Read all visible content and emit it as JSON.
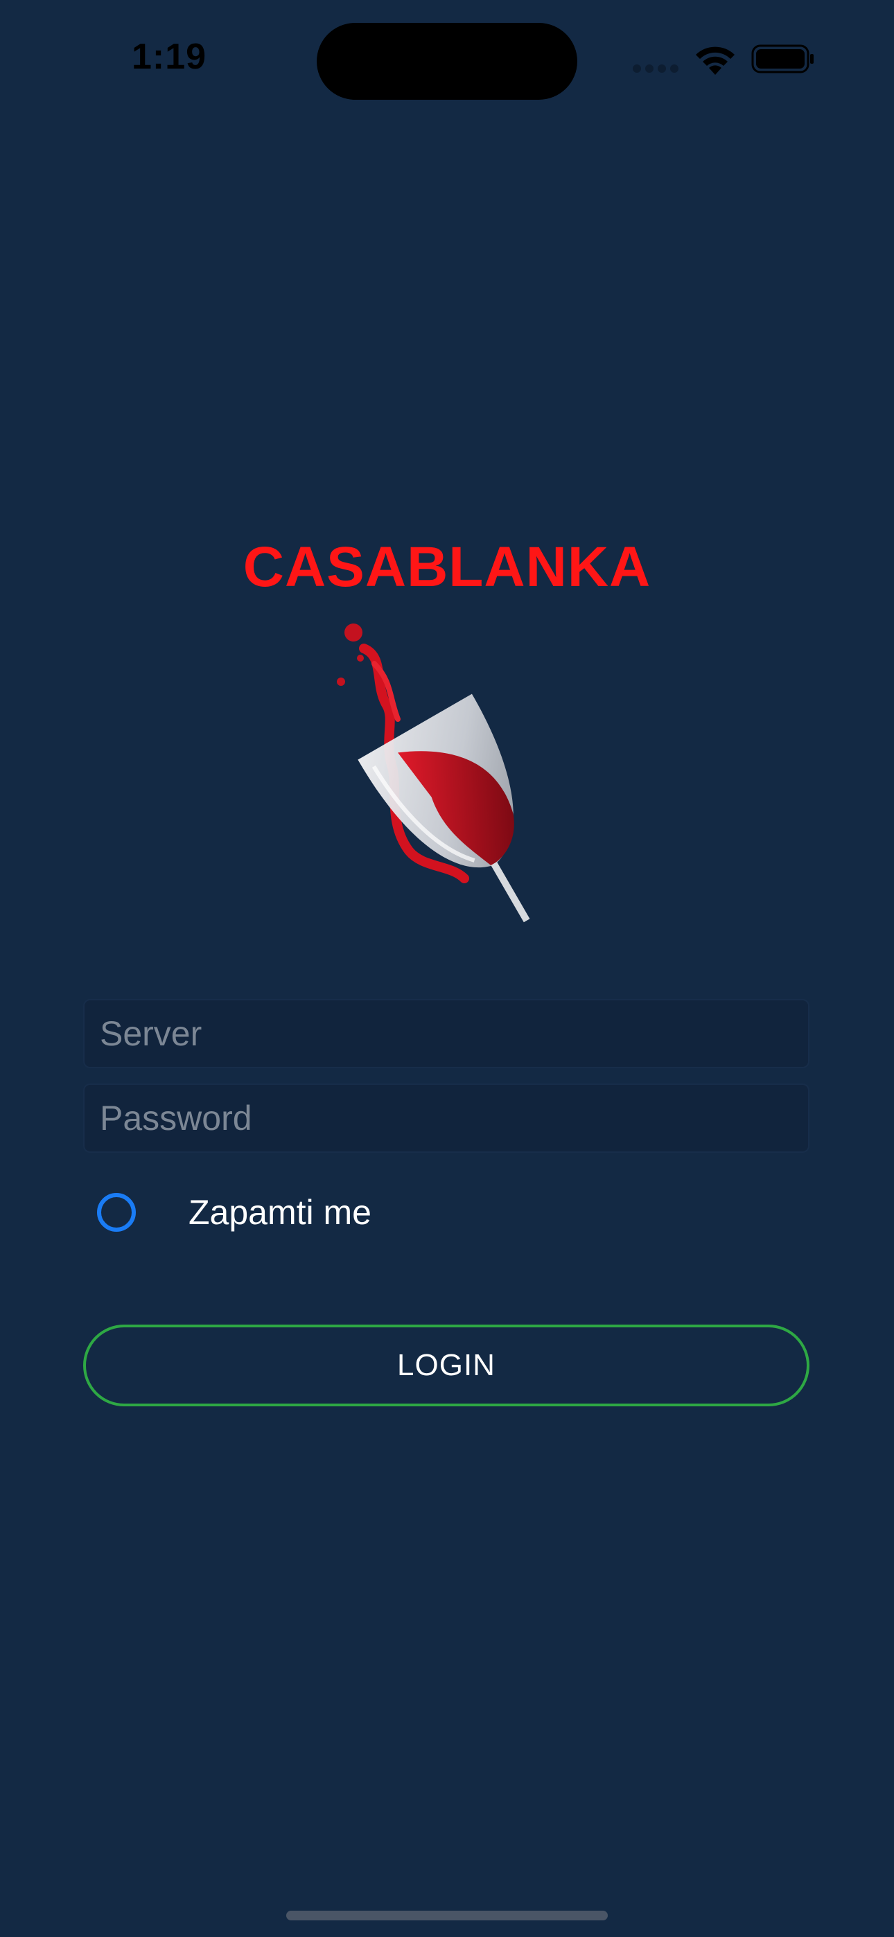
{
  "status_bar": {
    "time": "1:19"
  },
  "app": {
    "title": "CASABLANKA",
    "title_color": "#ff1616",
    "background_color": "#132944"
  },
  "logo": {
    "icon": "wine-glass-splash-icon"
  },
  "form": {
    "server": {
      "value": "",
      "placeholder": "Server"
    },
    "password": {
      "value": "",
      "placeholder": "Password"
    },
    "remember": {
      "label": "Zapamti me",
      "checked": false,
      "color": "#1a7cf5"
    },
    "login_button": {
      "label": "LOGIN",
      "border_color": "#2ea844"
    }
  }
}
